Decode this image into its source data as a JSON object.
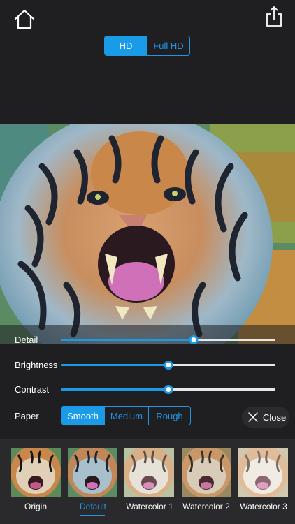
{
  "header": {
    "home_icon": "home-icon",
    "share_icon": "share-icon"
  },
  "quality": {
    "options": [
      "HD",
      "Full HD"
    ],
    "selected": "HD"
  },
  "controls": {
    "detail": {
      "label": "Detail",
      "value": 0.62
    },
    "brightness": {
      "label": "Brightness",
      "value": 0.5
    },
    "contrast": {
      "label": "Contrast",
      "value": 0.5
    },
    "paper": {
      "label": "Paper",
      "options": [
        "Smooth",
        "Medium",
        "Rough"
      ],
      "selected": "Smooth"
    },
    "close_label": "Close"
  },
  "filters": {
    "items": [
      {
        "label": "Origin"
      },
      {
        "label": "Default"
      },
      {
        "label": "Watercolor 1"
      },
      {
        "label": "Watercolor 2"
      },
      {
        "label": "Watercolor 3"
      }
    ],
    "selected": "Default"
  },
  "colors": {
    "accent": "#1a9be8",
    "background": "#1f1f21",
    "strip": "#2a2a2c"
  }
}
